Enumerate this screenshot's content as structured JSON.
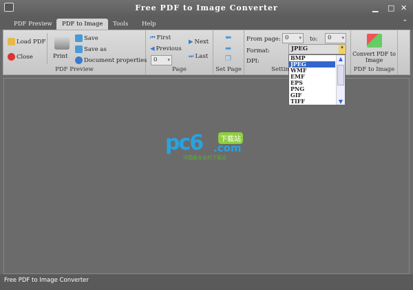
{
  "window": {
    "title": "Free PDF to Image Converter",
    "minimize": "▁",
    "maximize": "□",
    "close": "✕",
    "collapse": "⌃"
  },
  "tabs": [
    {
      "label": "PDF Preview"
    },
    {
      "label": "PDF to Image"
    },
    {
      "label": "Tools"
    },
    {
      "label": "Help"
    }
  ],
  "ribbon": {
    "pdf_preview": {
      "label": "PDF Preview",
      "load": "Load PDF",
      "close": "Close",
      "print": "Print",
      "save": "Save",
      "save_as": "Save as",
      "doc_props": "Document properties"
    },
    "page": {
      "label": "Page",
      "first": "First",
      "previous": "Previous",
      "next": "Next",
      "last": "Last",
      "page_value": "0"
    },
    "set_page": {
      "label": "Set Page"
    },
    "settings": {
      "label": "Settings",
      "from_label": "From page:",
      "from_value": "0",
      "to_label": "to:",
      "to_value": "0",
      "format_label": "Format:",
      "format_value": "JPEG",
      "dpi_label": "DPI:",
      "format_options": [
        "BMP",
        "JPEG",
        "WMF",
        "EMF",
        "EPS",
        "PNG",
        "GIF",
        "TIFF"
      ],
      "selected_index": 1
    },
    "convert": {
      "label": "PDF to Image",
      "button": "Convert PDF to Image"
    }
  },
  "watermark": {
    "logo": "pc6.com",
    "tag": "下载站",
    "sub": "中国最安全的下载站"
  },
  "status": {
    "text": "Free PDF to Image Converter"
  }
}
